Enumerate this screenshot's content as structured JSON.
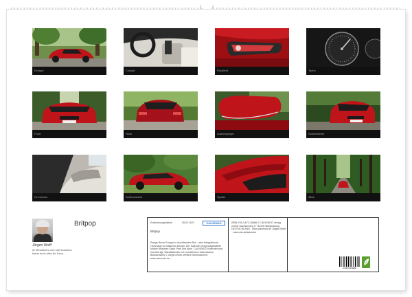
{
  "calendar": {
    "title": "Britpop",
    "author": {
      "name": "Jürgen Wolff",
      "description": "Ihr Bewährtes und Interessantes bietet euch alles für Fans..."
    },
    "photos": [
      {
        "caption": "Evoque"
      },
      {
        "caption": "Cockpit"
      },
      {
        "caption": "Rücklicht"
      },
      {
        "caption": "Tacho"
      },
      {
        "caption": "Front"
      },
      {
        "caption": "Heck"
      },
      {
        "caption": "Außenspiegel"
      },
      {
        "caption": "Scheinwerfer"
      },
      {
        "caption": "Innenraum"
      },
      {
        "caption": "Seitenansicht"
      },
      {
        "caption": "Spoiler"
      },
      {
        "caption": "Allee"
      }
    ],
    "back_label": {
      "col1": {
        "published_label": "Erscheinungsdatum",
        "date": "05.03.2021",
        "logo": "CALVENDO",
        "title": "Britpop",
        "text": "Range Rover Evoque in leuchtendem Rot – eine fotografische Hommage an britisches Design. Der Kalender zeigt ausgewählte Motive zwischen Stadt, Park und Allee. CALVENDO Kalender sind hochwertige Wandkalender mit monatlichem Kalendarium. Bildnachweis © Jürgen Wolff. Weitere Informationen: www.calvendo.de"
      },
      "col2": {
        "text": "ISBN 978-3-672-45688-2 CALVENDO Verlag GmbH Sachsenweg 6 · 84478 Waldkraiburg DEUTSCHLAND · www.calvendo.de Jürgen Wolff · calvendo.de/kalender"
      },
      "col3": {
        "barcode_number": "9783672456882",
        "ean_label": "EAN"
      }
    },
    "colors": {
      "car_red": "#c0141b",
      "frame_black": "#111111",
      "logo_blue": "#2c6fc4"
    }
  }
}
